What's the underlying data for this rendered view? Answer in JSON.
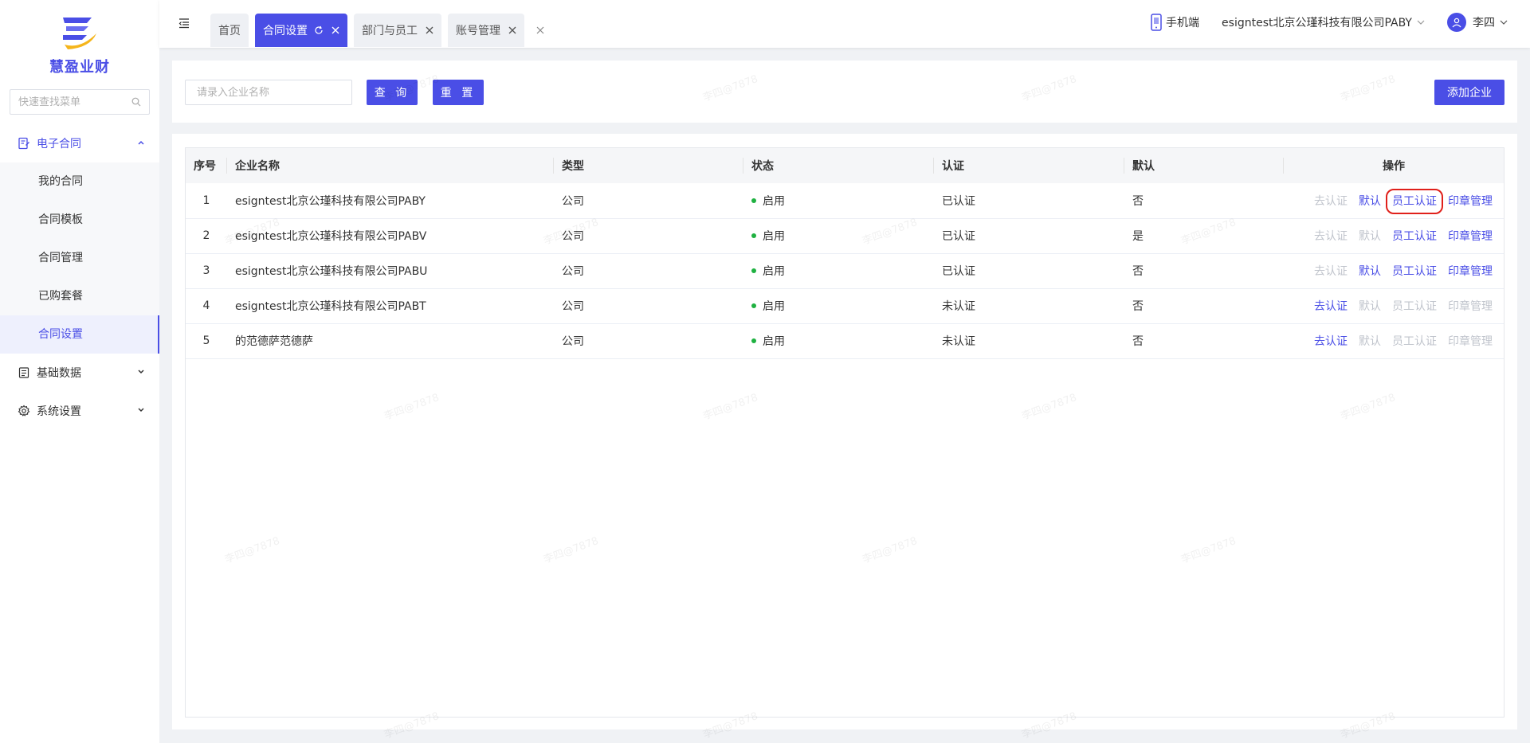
{
  "app": {
    "brand_name": "慧盈业财",
    "accent_color": "#4a4ee6"
  },
  "sidebar": {
    "search_placeholder": "快速查找菜单",
    "groups": [
      {
        "label": "电子合同",
        "icon": "contract-icon",
        "expanded": true,
        "items": [
          {
            "label": "我的合同"
          },
          {
            "label": "合同模板"
          },
          {
            "label": "合同管理"
          },
          {
            "label": "已购套餐"
          },
          {
            "label": "合同设置",
            "active": true
          }
        ]
      },
      {
        "label": "基础数据",
        "icon": "data-icon",
        "expanded": false
      },
      {
        "label": "系统设置",
        "icon": "gear-icon",
        "expanded": false
      }
    ]
  },
  "header": {
    "tabs": [
      {
        "label": "首页"
      },
      {
        "label": "合同设置",
        "active": true
      },
      {
        "label": "部门与员工"
      },
      {
        "label": "账号管理"
      }
    ],
    "mobile_label": "手机端",
    "company": "esigntest北京公瑾科技有限公司PABY",
    "user": "李四"
  },
  "filter": {
    "placeholder": "请录入企业名称",
    "query_label": "查 询",
    "reset_label": "重 置",
    "add_label": "添加企业"
  },
  "table": {
    "columns": [
      "序号",
      "企业名称",
      "类型",
      "状态",
      "认证",
      "默认",
      "操作"
    ],
    "rows": [
      {
        "no": "1",
        "name": "esigntest北京公瑾科技有限公司PABY",
        "type": "公司",
        "status": "启用",
        "cert": "已认证",
        "default": "否",
        "ops": {
          "go_cert": "去认证",
          "set_default": "默认",
          "emp_cert": "员工认证",
          "seal": "印章管理"
        }
      },
      {
        "no": "2",
        "name": "esigntest北京公瑾科技有限公司PABV",
        "type": "公司",
        "status": "启用",
        "cert": "已认证",
        "default": "是",
        "ops": {
          "go_cert": "去认证",
          "set_default": "默认",
          "emp_cert": "员工认证",
          "seal": "印章管理"
        }
      },
      {
        "no": "3",
        "name": "esigntest北京公瑾科技有限公司PABU",
        "type": "公司",
        "status": "启用",
        "cert": "已认证",
        "default": "否",
        "ops": {
          "go_cert": "去认证",
          "set_default": "默认",
          "emp_cert": "员工认证",
          "seal": "印章管理"
        }
      },
      {
        "no": "4",
        "name": "esigntest北京公瑾科技有限公司PABT",
        "type": "公司",
        "status": "启用",
        "cert": "未认证",
        "default": "否",
        "ops": {
          "go_cert": "去认证",
          "set_default": "默认",
          "emp_cert": "员工认证",
          "seal": "印章管理"
        }
      },
      {
        "no": "5",
        "name": "的范德萨范德萨",
        "type": "公司",
        "status": "启用",
        "cert": "未认证",
        "default": "否",
        "ops": {
          "go_cert": "去认证",
          "set_default": "默认",
          "emp_cert": "员工认证",
          "seal": "印章管理"
        }
      }
    ]
  },
  "watermark_text": "李四@7878"
}
